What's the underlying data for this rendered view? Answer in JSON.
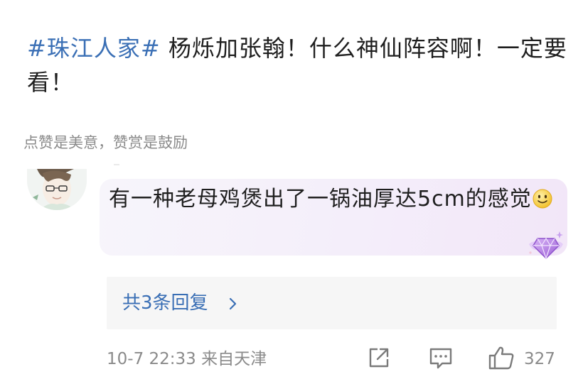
{
  "post": {
    "hashtag": "#珠江人家#",
    "text": " 杨烁加张翰！什么神仙阵容啊！一定要看！"
  },
  "reward_hint": "点赞是美意，赞赏是鼓励",
  "comment": {
    "text": "有一种老母鸡煲出了一锅油厚达5cm的感觉",
    "emoji": "smiley-emoji",
    "badge": "diamond-fan-badge",
    "replies_label": "共3条回复",
    "time": "10-7 22:33",
    "location": "来自天津",
    "like_count": "327"
  },
  "colors": {
    "link": "#3a6fb5",
    "meta": "#8a8a8a",
    "badge_purple": "#a46ad8"
  }
}
